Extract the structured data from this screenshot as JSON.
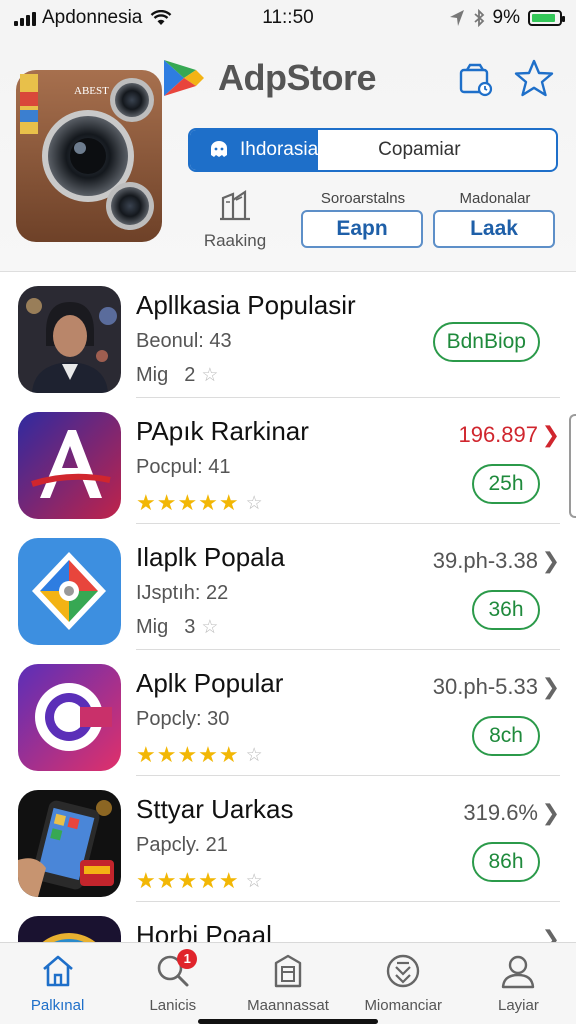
{
  "status_bar": {
    "carrier": "Apdonnesia",
    "time": "11::50",
    "battery": "9%",
    "battery_level": 0.9
  },
  "header": {
    "app_name": "AdpStore",
    "camera_label": "ABEST",
    "region_tab": "Ihdorasia",
    "search_placeholder": "Copamiar",
    "ranking_label": "Raaking",
    "filters": [
      {
        "heading": "Soroarstalns",
        "button": "Eapn"
      },
      {
        "heading": "Madonalar",
        "button": "Laak"
      }
    ]
  },
  "apps": [
    {
      "title": "Apllkasia Populasir",
      "subtitle": "Beonul: 43",
      "rating_text": "Mig",
      "rating_value": "2",
      "stars": 0,
      "price": "",
      "action": "BdnBiop",
      "icon": "portrait-photo-icon"
    },
    {
      "title": "PApık Rarkinar",
      "subtitle": "Pocpul: 41",
      "rating_text": "",
      "rating_value": "",
      "stars": 5,
      "price": "196.897",
      "action": "25h",
      "icon": "letter-a-icon"
    },
    {
      "title": "Ilaplk Popala",
      "subtitle": "IJsptıh: 22",
      "rating_text": "Mig",
      "rating_value": "3",
      "stars": 0,
      "price": "39.ph-3.38",
      "action": "36h",
      "icon": "pinwheel-icon"
    },
    {
      "title": "Aplk Popular",
      "subtitle": "Popcly: 30",
      "rating_text": "",
      "rating_value": "",
      "stars": 5,
      "price": "30.ph-5.33",
      "action": "8ch",
      "icon": "letter-c-icon"
    },
    {
      "title": "Sttyar Uarkas",
      "subtitle": "Papcly. 21",
      "rating_text": "",
      "rating_value": "",
      "stars": 5,
      "price": "319.6%",
      "action": "86h",
      "icon": "phone-photo-icon"
    },
    {
      "title": "Horbi Poaal",
      "subtitle": "",
      "rating_text": "",
      "rating_value": "",
      "stars": 0,
      "price": "",
      "action": "",
      "icon": "globe-icon"
    }
  ],
  "star_glyphs": {
    "full": "★★★★★",
    "empty": "☆"
  },
  "tabs": [
    {
      "label": "Palkınal",
      "icon": "home-icon",
      "active": true
    },
    {
      "label": "Lanicis",
      "icon": "search-icon",
      "badge": "1"
    },
    {
      "label": "Maannassat",
      "icon": "bag-icon"
    },
    {
      "label": "Miomanciar",
      "icon": "download-icon"
    },
    {
      "label": "Layiar",
      "icon": "profile-icon"
    }
  ],
  "colors": {
    "accent": "#1e6fc9",
    "install_green": "#2b9a4a",
    "price_red": "#d0262e",
    "star_gold": "#f2b705"
  }
}
